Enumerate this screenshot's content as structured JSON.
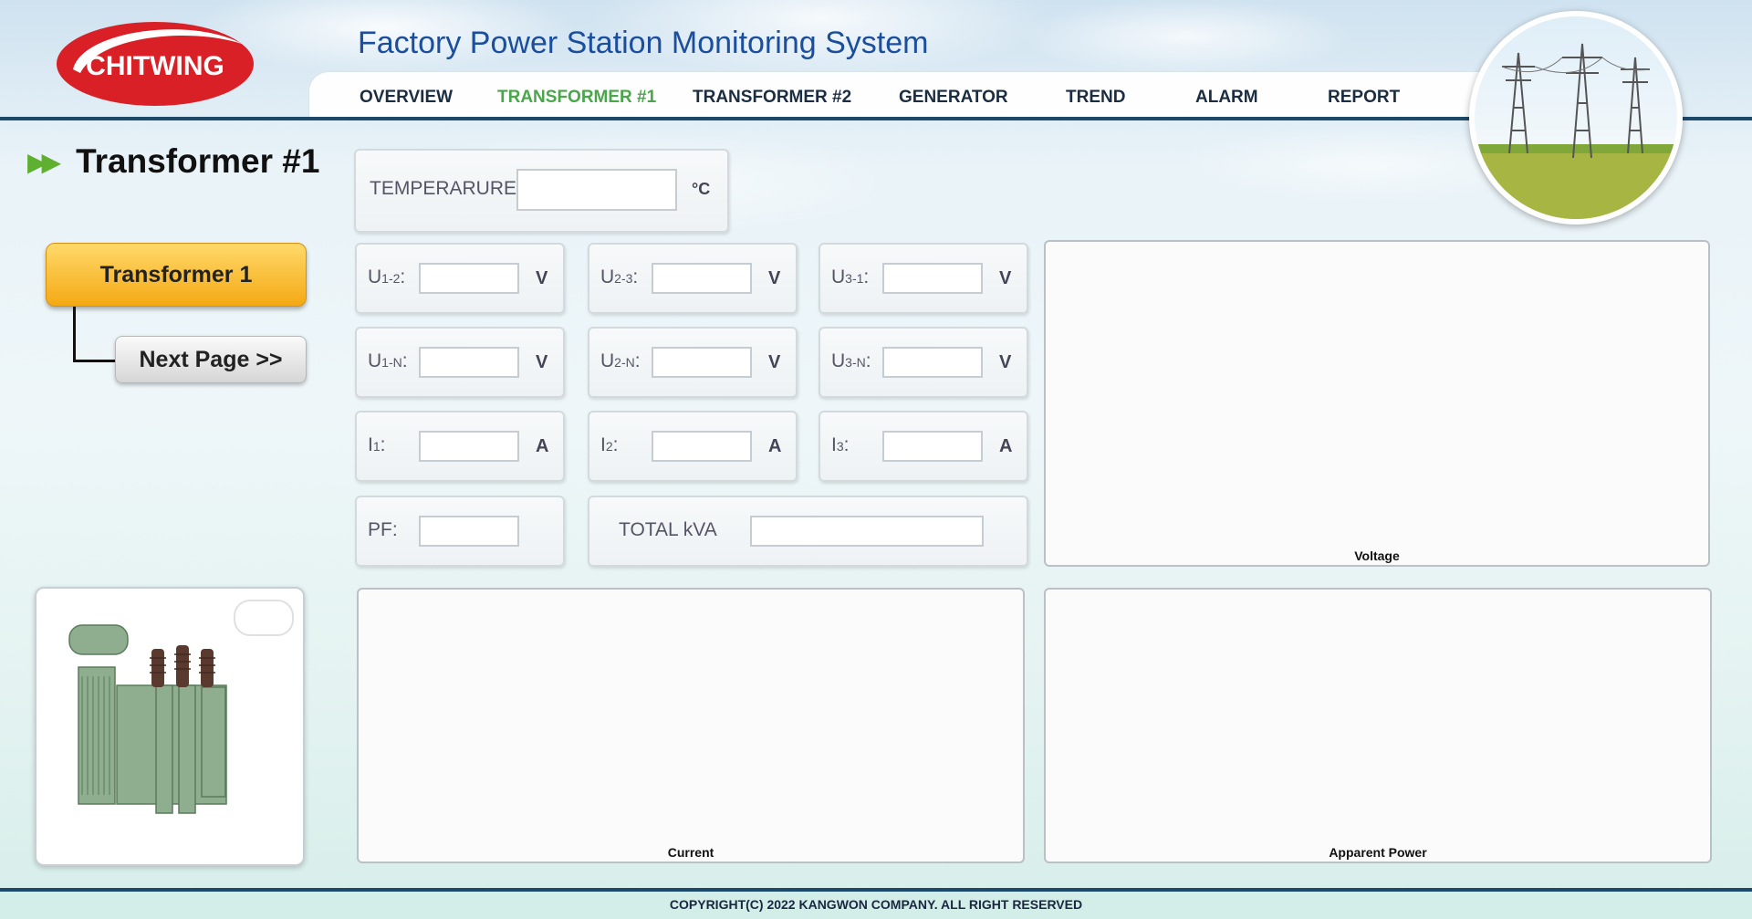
{
  "brand": {
    "logo_text": "CHITWING"
  },
  "app": {
    "title": "Factory Power Station Monitoring System"
  },
  "nav": {
    "items": [
      {
        "label": "OVERVIEW"
      },
      {
        "label": "TRANSFORMER #1"
      },
      {
        "label": "TRANSFORMER #2"
      },
      {
        "label": "GENERATOR"
      },
      {
        "label": "TREND"
      },
      {
        "label": "ALARM"
      },
      {
        "label": "REPORT"
      }
    ],
    "active": "TRANSFORMER #1",
    "active_color": "#4aa64a"
  },
  "page": {
    "heading": "Transformer #1",
    "heading_icon": "double-chevron-right-icon"
  },
  "sidebar": {
    "transformer_button": "Transformer 1",
    "next_page_button": "Next Page >>"
  },
  "readings": {
    "temperature": {
      "label": "TEMPERARURE:",
      "value": "",
      "unit": "°C"
    },
    "voltages_ll": [
      {
        "label_main": "U",
        "label_sub": "1-2",
        "label_colon": ":",
        "value": "",
        "unit": "V"
      },
      {
        "label_main": "U",
        "label_sub": "2-3",
        "label_colon": ":",
        "value": "",
        "unit": "V"
      },
      {
        "label_main": "U",
        "label_sub": "3-1",
        "label_colon": ":",
        "value": "",
        "unit": "V"
      }
    ],
    "voltages_ln": [
      {
        "label_main": "U",
        "label_sub": "1-N",
        "label_colon": ":",
        "value": "",
        "unit": "V"
      },
      {
        "label_main": "U",
        "label_sub": "2-N",
        "label_colon": ":",
        "value": "",
        "unit": "V"
      },
      {
        "label_main": "U",
        "label_sub": "3-N",
        "label_colon": ":",
        "value": "",
        "unit": "V"
      }
    ],
    "currents": [
      {
        "label_main": "I",
        "label_sub": "1",
        "label_colon": ":",
        "value": "",
        "unit": "A"
      },
      {
        "label_main": "I",
        "label_sub": "2",
        "label_colon": ":",
        "value": "",
        "unit": "A"
      },
      {
        "label_main": "I",
        "label_sub": "3",
        "label_colon": ":",
        "value": "",
        "unit": "A"
      }
    ],
    "pf": {
      "label": "PF:",
      "value": ""
    },
    "total_kva": {
      "label": "TOTAL kVA",
      "value": ""
    }
  },
  "charts": {
    "voltage": "Voltage",
    "current": "Current",
    "apparent_power": "Apparent Power"
  },
  "footer": {
    "copyright": "COPYRIGHT(C) 2022 KANGWON COMPANY. ALL RIGHT RESERVED"
  },
  "colors": {
    "header_line": "#1d4a68",
    "title_blue": "#1b4e9c",
    "brand_red": "#d92027",
    "button_orange": "#f4a914",
    "heading_arrow": "#5fb031"
  }
}
